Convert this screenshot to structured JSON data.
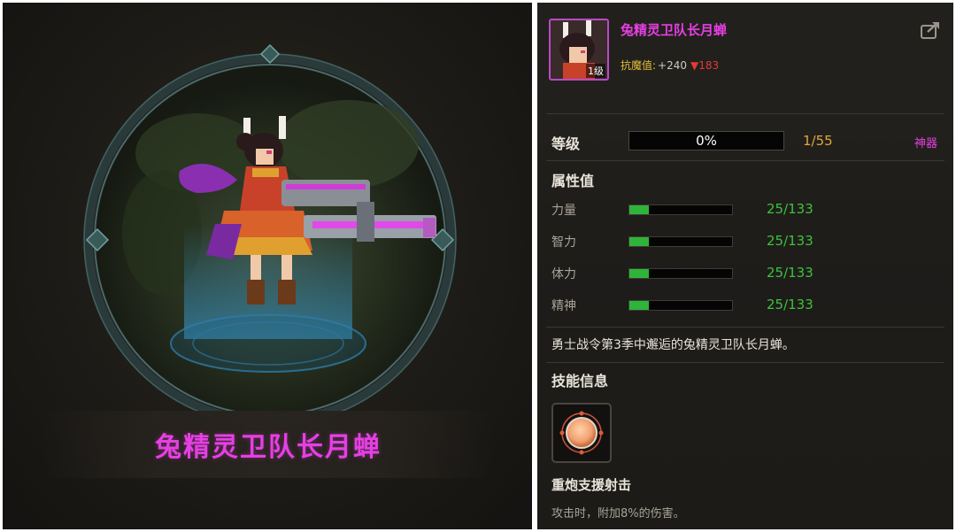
{
  "pet": {
    "name": "兔精灵卫队长月蝉",
    "level_badge": "1级"
  },
  "resistance": {
    "label": "抗魔值:",
    "value": "+240",
    "down_arrow": "▼",
    "down_value": "183"
  },
  "level": {
    "label": "等级",
    "progress_text": "0%",
    "progress_fraction": 0,
    "count": "1/55",
    "artifact_label": "神器"
  },
  "attributes": {
    "title": "属性值",
    "items": [
      {
        "label": "力量",
        "value": "25/133",
        "fraction": 0.19
      },
      {
        "label": "智力",
        "value": "25/133",
        "fraction": 0.19
      },
      {
        "label": "体力",
        "value": "25/133",
        "fraction": 0.19
      },
      {
        "label": "精神",
        "value": "25/133",
        "fraction": 0.19
      }
    ]
  },
  "description": "勇士战令第3季中邂逅的兔精灵卫队长月蝉。",
  "skill": {
    "section_title": "技能信息",
    "name": "重炮支援射击",
    "desc": "攻击时，附加8%的伤害。",
    "icon": "cannon-target-icon"
  },
  "icons": {
    "share": "share-icon",
    "portrait": "pet-portrait-icon"
  },
  "colors": {
    "name_magenta": "#e63fe3",
    "resist_gold": "#e3bf3a",
    "stat_green": "#3cc23c",
    "count_orange": "#e3a53a",
    "down_red": "#e53935"
  }
}
